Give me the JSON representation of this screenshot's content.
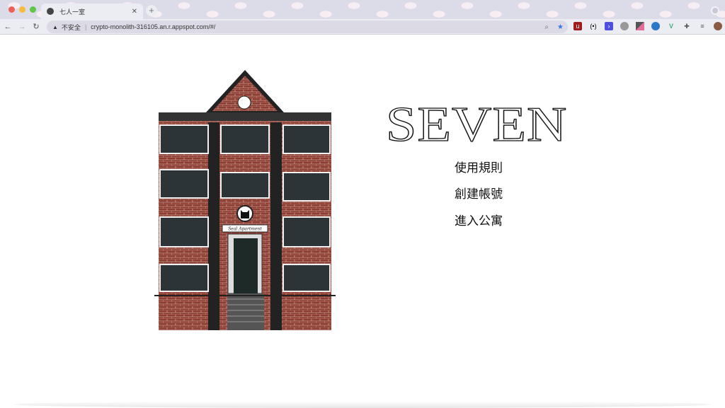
{
  "browser": {
    "tab_title": "七人一室",
    "security_label": "不安全",
    "url": "crypto-monolith-316105.an.r.appspot.com/#/",
    "extensions": [
      "ublock-icon",
      "code-icon",
      "terminal-icon",
      "robot-icon",
      "eyedropper-icon",
      "globe-icon",
      "vue-icon",
      "puzzle-icon",
      "playlist-icon",
      "avatar"
    ]
  },
  "page": {
    "title": "SEVEN",
    "menu": [
      "使用規則",
      "創建帳號",
      "進入公寓"
    ],
    "sign_text": "Seal Apartment"
  }
}
